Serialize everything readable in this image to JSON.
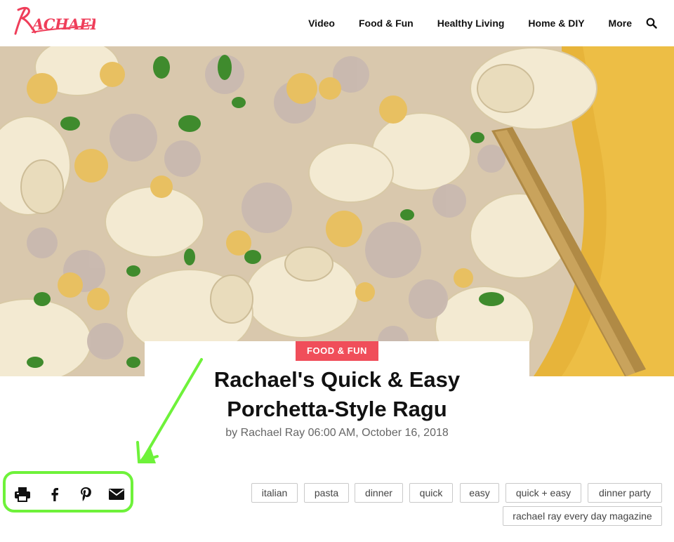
{
  "site": {
    "logo_text": "Rachael",
    "brand_color": "#ef3e5a"
  },
  "nav": {
    "items": [
      "Video",
      "Food & Fun",
      "Healthy Living",
      "Home & DIY",
      "More"
    ],
    "search_icon": "search-icon"
  },
  "article": {
    "category": "FOOD & FUN",
    "title_line1": "Rachael's Quick & Easy",
    "title_line2": "Porchetta-Style Ragu",
    "byline_prefix": "by",
    "author": "Rachael Ray",
    "published": "06:00 AM, October 16, 2018"
  },
  "share": {
    "icons": [
      "print-icon",
      "facebook-icon",
      "pinterest-icon",
      "email-icon"
    ],
    "highlight_color": "#6ef23a"
  },
  "tags": [
    "italian",
    "pasta",
    "dinner",
    "quick",
    "easy",
    "quick + easy",
    "dinner party",
    "rachael ray every day magazine"
  ],
  "colors": {
    "badge": "#f04e5a",
    "annotation_arrow": "#6ef23a"
  }
}
